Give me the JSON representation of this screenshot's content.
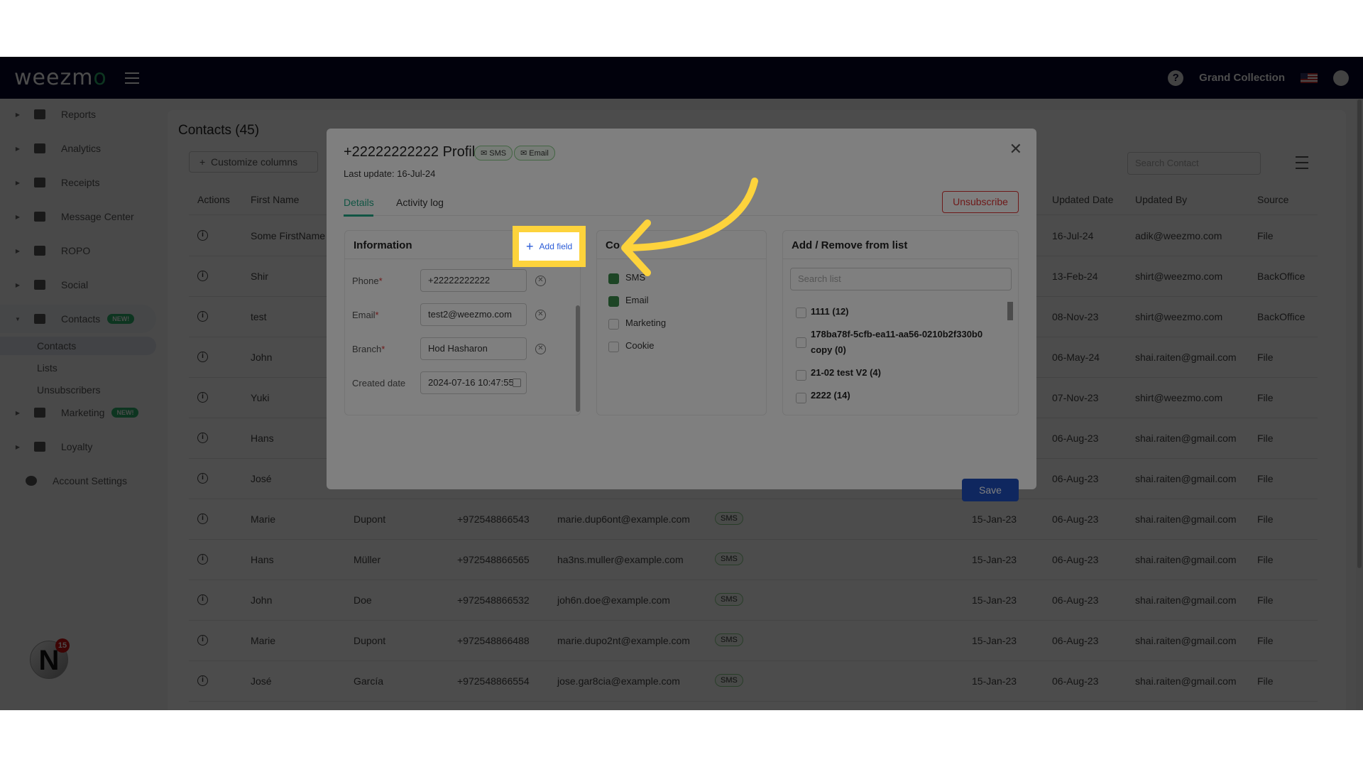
{
  "header": {
    "logo": "weezmo",
    "store": "Grand Collection",
    "help_icon": "help-icon",
    "user_icon": "user-icon"
  },
  "sidebar": {
    "items": [
      {
        "label": "Reports"
      },
      {
        "label": "Analytics"
      },
      {
        "label": "Receipts"
      },
      {
        "label": "Message Center"
      },
      {
        "label": "ROPO"
      },
      {
        "label": "Social"
      },
      {
        "label": "Contacts",
        "badge": "NEW!"
      },
      {
        "label": "Marketing",
        "badge": "NEW!"
      },
      {
        "label": "Loyalty"
      },
      {
        "label": "Account Settings"
      }
    ],
    "subitems": [
      "Contacts",
      "Lists",
      "Unsubscribers"
    ],
    "notification_count": "15"
  },
  "page": {
    "title": "Contacts (45)",
    "customize": "Customize columns",
    "search_placeholder": "Search Contact"
  },
  "table": {
    "headers": [
      "Actions",
      "First Name",
      "Updated Date",
      "Updated By",
      "Source"
    ],
    "rows": [
      {
        "first": "Some FirstName",
        "updated": "16-Jul-24",
        "by": "adik@weezmo.com",
        "source": "File"
      },
      {
        "first": "Shir",
        "updated": "13-Feb-24",
        "by": "shirt@weezmo.com",
        "source": "BackOffice"
      },
      {
        "first": "test",
        "updated": "08-Nov-23",
        "by": "shirt@weezmo.com",
        "source": "BackOffice"
      },
      {
        "first": "John",
        "updated": "06-May-24",
        "by": "shai.raiten@gmail.com",
        "source": "File"
      },
      {
        "first": "Yuki",
        "updated": "07-Nov-23",
        "by": "shirt@weezmo.com",
        "source": "File"
      },
      {
        "first": "Hans",
        "updated": "06-Aug-23",
        "by": "shai.raiten@gmail.com",
        "source": "File"
      },
      {
        "first": "José",
        "updated": "06-Aug-23",
        "by": "shai.raiten@gmail.com",
        "source": "File"
      },
      {
        "first": "Marie",
        "last": "Dupont",
        "phone": "+972548866543",
        "email": "marie.dup6ont@example.com",
        "channel": "SMS",
        "created": "15-Jan-23",
        "updated": "06-Aug-23",
        "by": "shai.raiten@gmail.com",
        "source": "File"
      },
      {
        "first": "Hans",
        "last": "Müller",
        "phone": "+972548866565",
        "email": "ha3ns.muller@example.com",
        "channel": "SMS",
        "created": "15-Jan-23",
        "updated": "06-Aug-23",
        "by": "shai.raiten@gmail.com",
        "source": "File"
      },
      {
        "first": "John",
        "last": "Doe",
        "phone": "+972548866532",
        "email": "joh6n.doe@example.com",
        "channel": "SMS",
        "created": "15-Jan-23",
        "updated": "06-Aug-23",
        "by": "shai.raiten@gmail.com",
        "source": "File"
      },
      {
        "first": "Marie",
        "last": "Dupont",
        "phone": "+972548866488",
        "email": "marie.dupo2nt@example.com",
        "channel": "SMS",
        "created": "15-Jan-23",
        "updated": "06-Aug-23",
        "by": "shai.raiten@gmail.com",
        "source": "File"
      },
      {
        "first": "José",
        "last": "García",
        "phone": "+972548866554",
        "email": "jose.gar8cia@example.com",
        "channel": "SMS",
        "created": "15-Jan-23",
        "updated": "06-Aug-23",
        "by": "shai.raiten@gmail.com",
        "source": "File"
      }
    ]
  },
  "modal": {
    "title": "+22222222222 Profile:",
    "chips": [
      "SMS",
      "Email"
    ],
    "last_update": "Last update: 16-Jul-24",
    "tabs": [
      "Details",
      "Activity log"
    ],
    "unsubscribe": "Unsubscribe",
    "info": {
      "title": "Information",
      "add_field": "Add field",
      "fields": [
        {
          "label": "Phone",
          "value": "+22222222222",
          "required": true
        },
        {
          "label": "Email",
          "value": "test2@weezmo.com",
          "required": true
        },
        {
          "label": "Branch",
          "value": "Hod Hasharon",
          "required": true
        },
        {
          "label": "Created date",
          "value": "2024-07-16 10:47:55"
        }
      ]
    },
    "consent": {
      "title": "Co",
      "items": [
        {
          "label": "SMS",
          "checked": true
        },
        {
          "label": "Email",
          "checked": true
        },
        {
          "label": "Marketing",
          "checked": false
        },
        {
          "label": "Cookie",
          "checked": false
        }
      ]
    },
    "lists": {
      "title": "Add / Remove from list",
      "search_placeholder": "Search list",
      "items": [
        "1111 (12)",
        "178ba78f-5cfb-ea11-aa56-0210b2f330b0",
        "copy (0)",
        "21-02 test V2 (4)",
        "2222 (14)"
      ]
    },
    "save": "Save"
  },
  "colors": {
    "header": "#04042a",
    "accent": "#2db36b",
    "highlight": "#fdd33c",
    "save": "#1f4fbf",
    "danger": "#dd3333"
  }
}
